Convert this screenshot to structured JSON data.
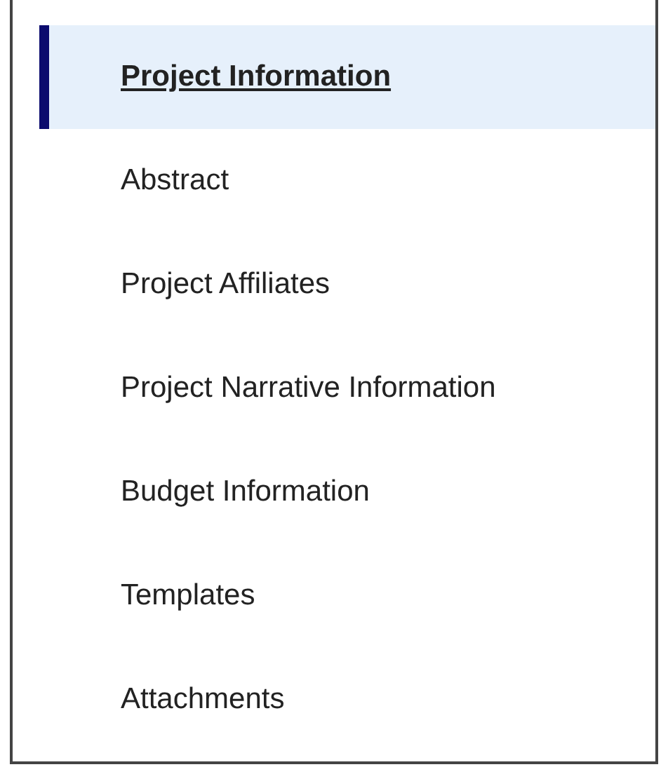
{
  "nav": {
    "items": [
      {
        "label": "Project Information",
        "selected": true
      },
      {
        "label": "Abstract",
        "selected": false
      },
      {
        "label": "Project Affiliates",
        "selected": false
      },
      {
        "label": "Project Narrative Information",
        "selected": false
      },
      {
        "label": "Budget Information",
        "selected": false
      },
      {
        "label": "Templates",
        "selected": false
      },
      {
        "label": "Attachments",
        "selected": false
      }
    ]
  }
}
